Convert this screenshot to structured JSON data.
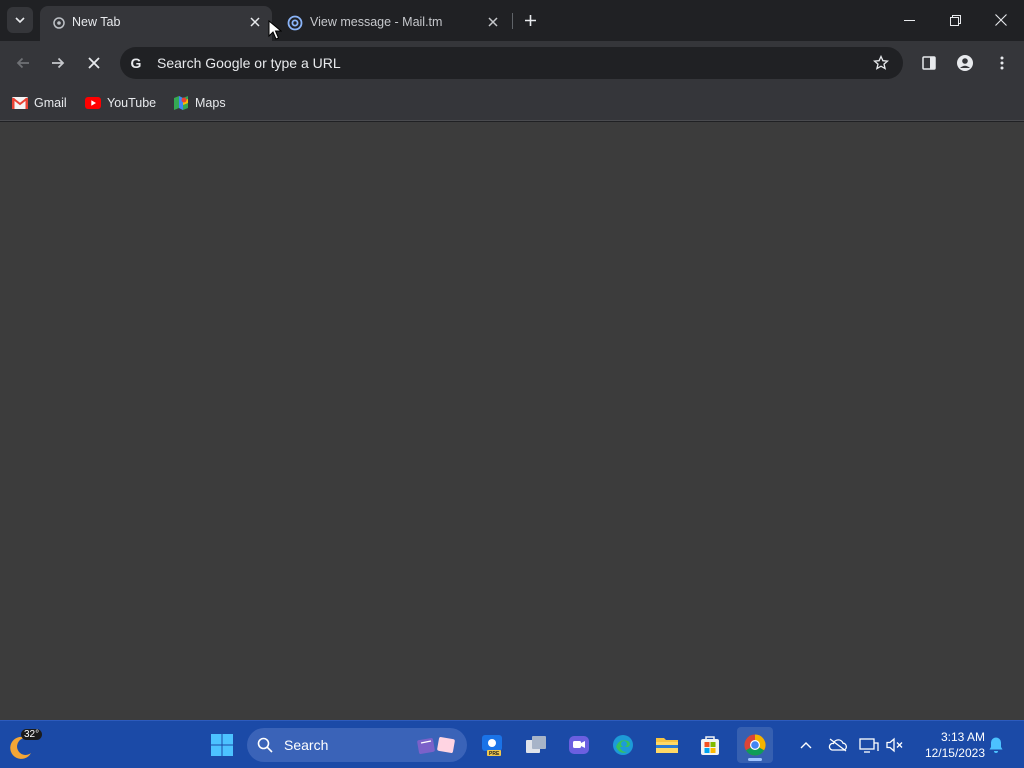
{
  "browser": {
    "tabs": [
      {
        "title": "New Tab",
        "favicon": "chrome-newtab-icon",
        "active": true
      },
      {
        "title": "View message - Mail.tm",
        "favicon": "at-sign-icon",
        "active": false
      }
    ],
    "omnibox": {
      "placeholder": "Search Google or type a URL"
    },
    "bookmarks": [
      {
        "label": "Gmail",
        "icon": "gmail-icon"
      },
      {
        "label": "YouTube",
        "icon": "youtube-icon"
      },
      {
        "label": "Maps",
        "icon": "maps-icon"
      }
    ]
  },
  "taskbar": {
    "weather_temp": "32°",
    "search_label": "Search",
    "clock_time": "3:13 AM",
    "clock_date": "12/15/2023"
  },
  "colors": {
    "chrome_dark": "#202124",
    "toolbar": "#35363a",
    "page_bg": "#3c3c3c",
    "taskbar": "#1b4aa7"
  }
}
